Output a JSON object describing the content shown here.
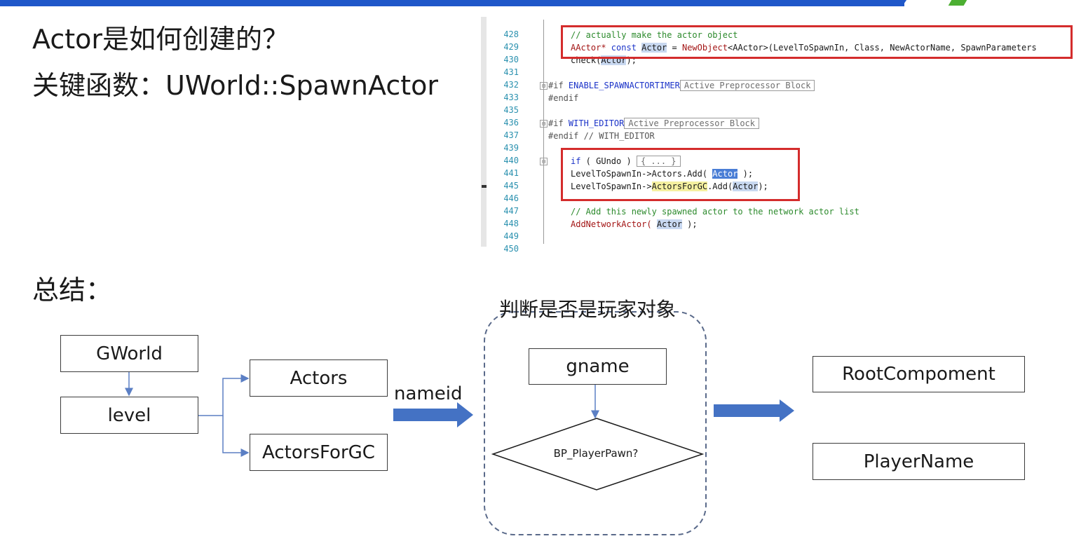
{
  "colors": {
    "banner": "#1f57c9",
    "logo_green": "#4caf32",
    "connector": "#5b7fc4",
    "block_arrow": "#4472c4",
    "highlight_box": "#d42c2c",
    "code_comment": "#2c8a2c",
    "code_keyword": "#1a32c8",
    "line_number": "#2b91af"
  },
  "headings": {
    "question": "Actor是如何创建的？",
    "key_function": "关键函数：UWorld::SpawnActor",
    "summary": "总结："
  },
  "code": {
    "l428": {
      "num": "428"
    },
    "l429": {
      "num": "429",
      "text": "// actually make the actor object"
    },
    "l430": {
      "num": "430",
      "a": "AActor* ",
      "b": "const ",
      "actor": "Actor",
      "c": " = ",
      "d": "NewObject",
      "e": "<AActor>(LevelToSpawnIn, Class, NewActorName, SpawnParameters"
    },
    "l431": {
      "num": "431",
      "a": "check(",
      "actor": "Actor",
      "b": ");"
    },
    "l432": {
      "num": "432"
    },
    "l433": {
      "num": "433",
      "fold": "⊞",
      "a": "#if ",
      "b": "ENABLE_SPAWNACTORTIMER",
      "collapsed": "Active Preprocessor Block"
    },
    "l435": {
      "num": "435",
      "a": "#endif"
    },
    "l436": {
      "num": "436"
    },
    "l437": {
      "num": "437",
      "fold": "⊞",
      "a": "#if ",
      "b": "WITH_EDITOR",
      "collapsed": "Active Preprocessor Block"
    },
    "l439": {
      "num": "439",
      "a": "#endif // WITH_EDITOR"
    },
    "l440": {
      "num": "440"
    },
    "l441": {
      "num": "441",
      "fold": "⊞",
      "a": "if",
      "b": " ( GUndo ) ",
      "collapsed": "{ ... }"
    },
    "l445": {
      "num": "445",
      "a": "LevelToSpawnIn->Actors.Add( ",
      "actor": "Actor",
      "b": " );"
    },
    "l446": {
      "num": "446",
      "a": "LevelToSpawnIn->",
      "gc": "ActorsForGC",
      "b": ".Add(",
      "actor": "Actor",
      "c": ");"
    },
    "l447": {
      "num": "447"
    },
    "l448": {
      "num": "448",
      "text": "// Add this newly spawned actor to the network actor list"
    },
    "l449": {
      "num": "449",
      "a": "AddNetworkActor( ",
      "actor": "Actor",
      "b": " );"
    },
    "l450": {
      "num": "450"
    }
  },
  "diagram": {
    "gworld": "GWorld",
    "level": "level",
    "actors": "Actors",
    "actors_for_gc": "ActorsForGC",
    "nameid": "nameid",
    "group_title": "判断是否是玩家对象",
    "gname": "gname",
    "decision": "BP_PlayerPawn?",
    "root_component": "RootCompoment",
    "player_name": "PlayerName"
  }
}
